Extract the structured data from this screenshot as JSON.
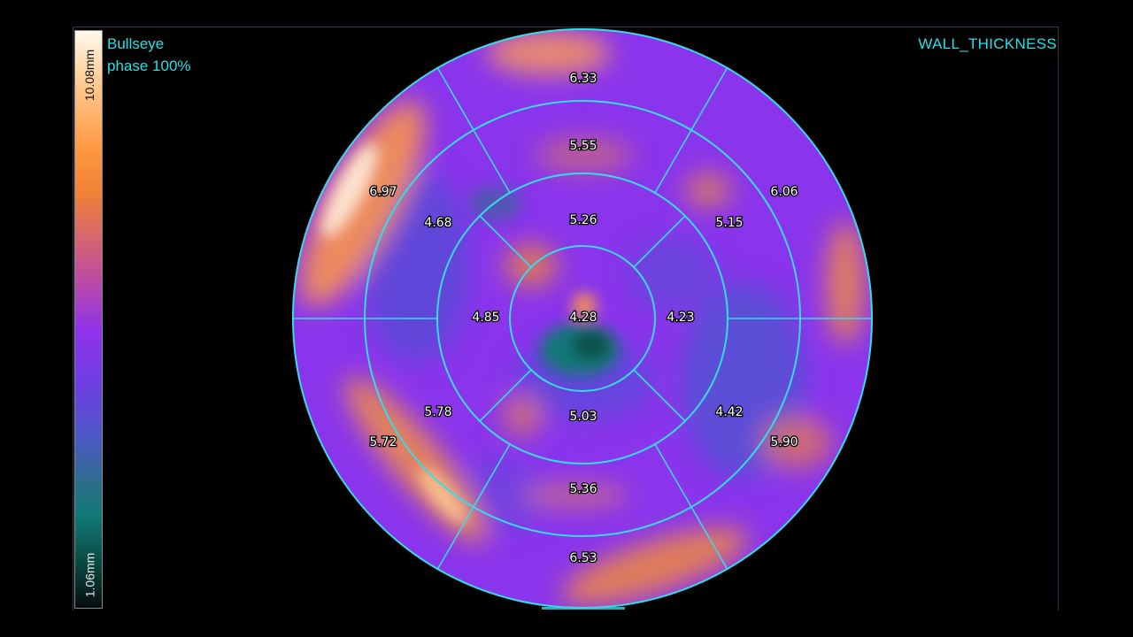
{
  "overlay": {
    "title_line1": "Bullseye",
    "title_line2": "phase 100%",
    "metric": "WALL_THICKNESS"
  },
  "colorbar": {
    "max_label": "10.08mm",
    "min_label": "1.06mm",
    "colors": [
      "#fff8ef",
      "#ffcf99",
      "#ff9a45",
      "#c24f9c",
      "#8f33ea",
      "#4f57c8",
      "#117a76",
      "#050d0c"
    ]
  },
  "segments": {
    "basal": [
      "6.33",
      "6.06",
      "5.90",
      "6.53",
      "5.72",
      "6.97"
    ],
    "mid": [
      "5.55",
      "5.15",
      "4.42",
      "5.36",
      "5.78",
      "4.68"
    ],
    "apical": [
      "5.26",
      "4.23",
      "5.03",
      "4.85"
    ],
    "apex": "4.28"
  },
  "colors": {
    "ring_lines": "#35dce8",
    "overlay_text": "#27e0e6",
    "base_purple": "#8a35ec"
  }
}
